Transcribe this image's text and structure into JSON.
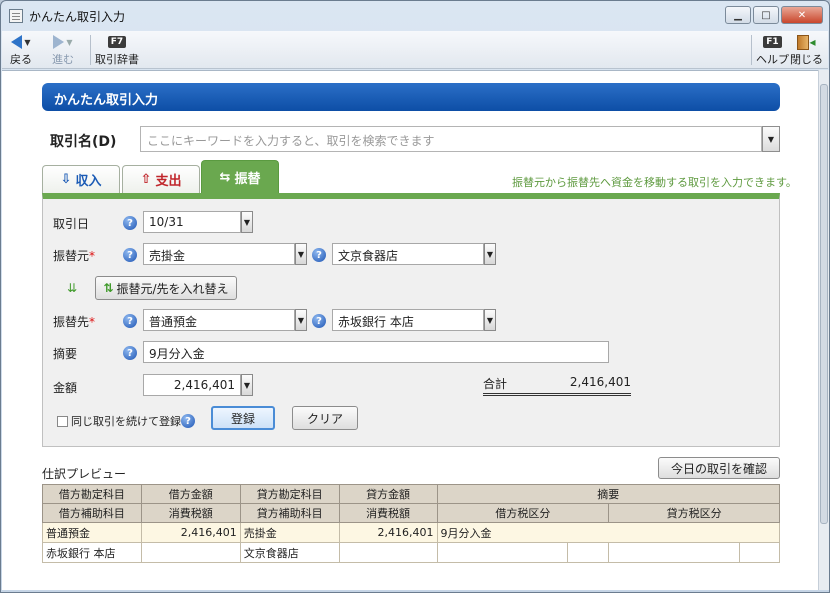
{
  "window": {
    "title": "かんたん取引入力"
  },
  "toolbar": {
    "back": "戻る",
    "forward": "進む",
    "dict_key": "F7",
    "dict": "取引辞書",
    "help_key": "F1",
    "help": "ヘルプ",
    "close": "閉じる"
  },
  "header": {
    "title": "かんたん取引入力"
  },
  "search": {
    "label": "取引名(D)",
    "placeholder": "ここにキーワードを入力すると、取引を検索できます"
  },
  "tabs": [
    {
      "label": "収入"
    },
    {
      "label": "支出"
    },
    {
      "label": "振替"
    }
  ],
  "tab_hint": "振替元から振替先へ資金を移動する取引を入力できます。",
  "form": {
    "date_label": "取引日",
    "date_value": "10/31",
    "from_label": "振替元",
    "from_account": "売掛金",
    "from_sub": "文京食器店",
    "swap_button": "振替元/先を入れ替え",
    "to_label": "振替先",
    "to_account": "普通預金",
    "to_sub": "赤坂銀行 本店",
    "memo_label": "摘要",
    "memo_value": "9月分入金",
    "amount_label": "金額",
    "amount_value": "2,416,401",
    "total_label": "合計",
    "total_value": "2,416,401",
    "repeat_label": "同じ取引を続けて登録",
    "register_button": "登録",
    "clear_button": "クリア",
    "required_mark": "*",
    "help_mark": "?"
  },
  "preview": {
    "label": "仕訳プレビュー",
    "today_button": "今日の取引を確認",
    "header1": [
      "借方勘定科目",
      "借方金額",
      "貸方勘定科目",
      "貸方金額",
      "摘要"
    ],
    "header2": [
      "借方補助科目",
      "消費税額",
      "貸方補助科目",
      "消費税額",
      "借方税区分",
      "貸方税区分"
    ],
    "row1": [
      "普通預金",
      "2,416,401",
      "売掛金",
      "2,416,401",
      "9月分入金"
    ],
    "row2": [
      "赤坂銀行 本店",
      "",
      "文京食器店",
      "",
      "",
      "",
      "",
      ""
    ]
  }
}
